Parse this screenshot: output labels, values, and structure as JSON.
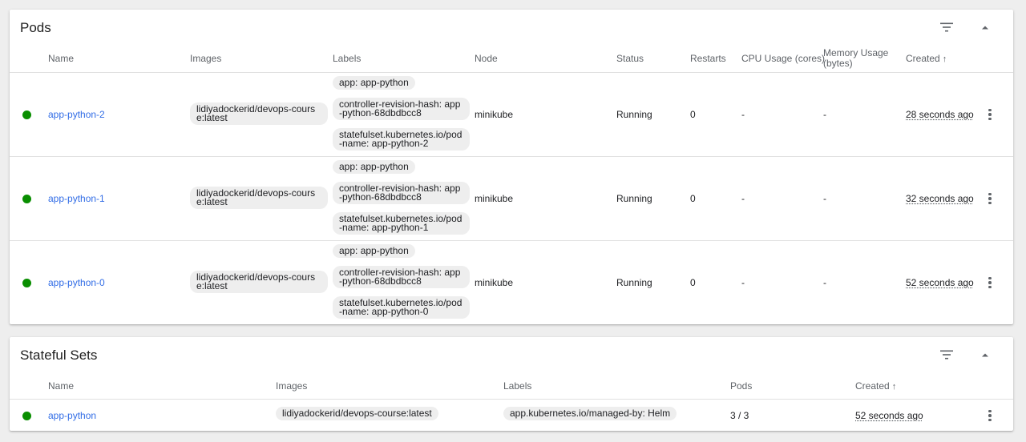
{
  "pods": {
    "title": "Pods",
    "columns": {
      "name": "Name",
      "images": "Images",
      "labels": "Labels",
      "node": "Node",
      "status": "Status",
      "restarts": "Restarts",
      "cpu": "CPU Usage (cores)",
      "memory": "Memory Usage (bytes)",
      "created": "Created",
      "sort_icon": "↑"
    },
    "rows": [
      {
        "name": "app-python-2",
        "image": "lidiyadockerid/devops-course:latest",
        "labels": [
          "app: app-python",
          "controller-revision-hash: app-python-68dbdbcc8",
          "statefulset.kubernetes.io/pod-name: app-python-2"
        ],
        "node": "minikube",
        "status": "Running",
        "restarts": "0",
        "cpu": "-",
        "memory": "-",
        "created": "28 seconds ago"
      },
      {
        "name": "app-python-1",
        "image": "lidiyadockerid/devops-course:latest",
        "labels": [
          "app: app-python",
          "controller-revision-hash: app-python-68dbdbcc8",
          "statefulset.kubernetes.io/pod-name: app-python-1"
        ],
        "node": "minikube",
        "status": "Running",
        "restarts": "0",
        "cpu": "-",
        "memory": "-",
        "created": "32 seconds ago"
      },
      {
        "name": "app-python-0",
        "image": "lidiyadockerid/devops-course:latest",
        "labels": [
          "app: app-python",
          "controller-revision-hash: app-python-68dbdbcc8",
          "statefulset.kubernetes.io/pod-name: app-python-0"
        ],
        "node": "minikube",
        "status": "Running",
        "restarts": "0",
        "cpu": "-",
        "memory": "-",
        "created": "52 seconds ago"
      }
    ]
  },
  "stateful_sets": {
    "title": "Stateful Sets",
    "columns": {
      "name": "Name",
      "images": "Images",
      "labels": "Labels",
      "pods": "Pods",
      "created": "Created",
      "sort_icon": "↑"
    },
    "rows": [
      {
        "name": "app-python",
        "image": "lidiyadockerid/devops-course:latest",
        "label": "app.kubernetes.io/managed-by: Helm",
        "pods": "3 / 3",
        "created": "52 seconds ago"
      }
    ]
  },
  "icons": {
    "filter": "filter-list-icon",
    "collapse": "arrow-drop-up-icon",
    "more": "more-vert-icon",
    "status_ok": "status-running-icon"
  },
  "colors": {
    "link": "#326de6",
    "status_ok": "#098e00",
    "chip_bg": "#eeeeee",
    "page_bg": "#eeeeee"
  }
}
